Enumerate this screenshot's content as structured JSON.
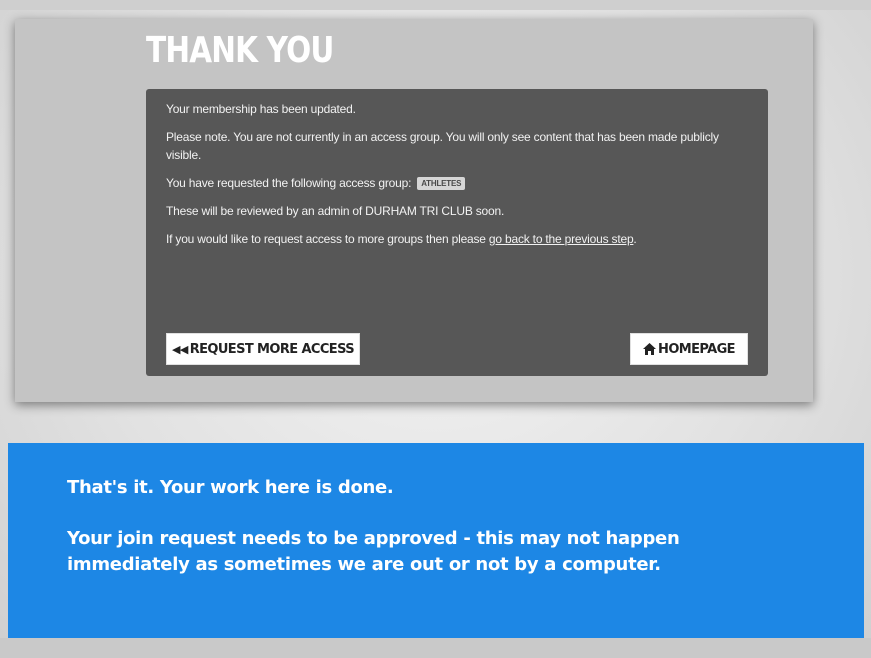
{
  "card": {
    "title": "THANK YOU",
    "messages": {
      "updated": "Your membership has been updated.",
      "note": "Please note. You are not currently in an access group. You will only see content that has been made publicly visible.",
      "requested_prefix": "You have requested the following access group:",
      "requested_group": "ATHLETES",
      "review": "These will be reviewed by an admin of DURHAM TRI CLUB soon.",
      "more_prefix": "If you would like to request access to more groups then please ",
      "more_link": "go back to the previous step",
      "more_suffix": "."
    },
    "buttons": {
      "request_more_access": "REQUEST MORE ACCESS",
      "homepage": "HOMEPAGE"
    },
    "icons": {
      "request_more_access": "double-chevron-left-icon",
      "homepage": "home-icon"
    }
  },
  "banner": {
    "line1": "That's it. Your work here is done.",
    "line2": "Your join request needs to be approved - this may not happen immediately as sometimes we are out or not by a computer."
  },
  "colors": {
    "card_bg": "#c4c4c4",
    "notice_bg": "#575757",
    "banner_bg": "#1d87e5",
    "button_bg": "#ffffff"
  }
}
